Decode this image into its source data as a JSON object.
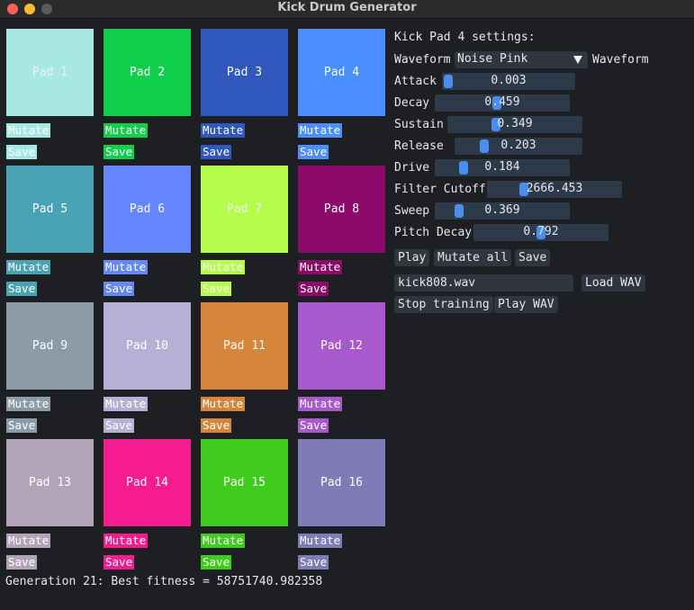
{
  "window": {
    "title": "Kick Drum Generator"
  },
  "pads": [
    {
      "label": "Pad 1",
      "color": "#a7e8e2",
      "text_color": "#f0f0f0",
      "mutate": "Mutate",
      "save": "Save"
    },
    {
      "label": "Pad 2",
      "color": "#10cf4b",
      "text_color": "#ffffff",
      "mutate": "Mutate",
      "save": "Save"
    },
    {
      "label": "Pad 3",
      "color": "#3158bd",
      "text_color": "#ffffff",
      "mutate": "Mutate",
      "save": "Save"
    },
    {
      "label": "Pad 4",
      "color": "#4a8eff",
      "text_color": "#ffffff",
      "mutate": "Mutate",
      "save": "Save"
    },
    {
      "label": "Pad 5",
      "color": "#4aa3b5",
      "text_color": "#ffffff",
      "mutate": "Mutate",
      "save": "Save"
    },
    {
      "label": "Pad 6",
      "color": "#6486ff",
      "text_color": "#ffffff",
      "mutate": "Mutate",
      "save": "Save"
    },
    {
      "label": "Pad 7",
      "color": "#b4fd4b",
      "text_color": "#f0f0f0",
      "mutate": "Mutate",
      "save": "Save"
    },
    {
      "label": "Pad 8",
      "color": "#8b0a6a",
      "text_color": "#ffffff",
      "mutate": "Mutate",
      "save": "Save"
    },
    {
      "label": "Pad 9",
      "color": "#8c9ba8",
      "text_color": "#ffffff",
      "mutate": "Mutate",
      "save": "Save"
    },
    {
      "label": "Pad 10",
      "color": "#b5b1d6",
      "text_color": "#ffffff",
      "mutate": "Mutate",
      "save": "Save"
    },
    {
      "label": "Pad 11",
      "color": "#d5863a",
      "text_color": "#ffffff",
      "mutate": "Mutate",
      "save": "Save"
    },
    {
      "label": "Pad 12",
      "color": "#a859cc",
      "text_color": "#ffffff",
      "mutate": "Mutate",
      "save": "Save"
    },
    {
      "label": "Pad 13",
      "color": "#b3a3b9",
      "text_color": "#ffffff",
      "mutate": "Mutate",
      "save": "Save"
    },
    {
      "label": "Pad 14",
      "color": "#f51c8f",
      "text_color": "#ffffff",
      "mutate": "Mutate",
      "save": "Save"
    },
    {
      "label": "Pad 15",
      "color": "#3fcc1c",
      "text_color": "#ffffff",
      "mutate": "Mutate",
      "save": "Save"
    },
    {
      "label": "Pad 16",
      "color": "#7f7bb6",
      "text_color": "#ffffff",
      "mutate": "Mutate",
      "save": "Save"
    }
  ],
  "settings": {
    "heading": "Kick Pad 4 settings:",
    "waveform": {
      "label": "Waveform",
      "value": "Noise Pink",
      "suffix": "Waveform"
    },
    "params": [
      {
        "label": "Attack",
        "value": "0.003",
        "level": 0.003
      },
      {
        "label": "Decay",
        "value": "0.459",
        "level": 0.459
      },
      {
        "label": "Sustain",
        "value": "0.349",
        "level": 0.349
      },
      {
        "label": "Release",
        "value": "0.203",
        "level": 0.203
      },
      {
        "label": "Drive",
        "value": "0.184",
        "level": 0.184
      },
      {
        "label": "Filter Cutoff",
        "value": "2666.453",
        "level": 0.25
      },
      {
        "label": "Sweep",
        "value": "0.369",
        "level": 0.15
      },
      {
        "label": "Pitch Decay",
        "value": "0.792",
        "level": 0.5
      }
    ],
    "buttons": {
      "play": "Play",
      "mutate_all": "Mutate all",
      "save": "Save"
    },
    "file_input": "kick808.wav",
    "load_wav": "Load WAV",
    "stop_training": "Stop training",
    "play_wav": "Play WAV"
  },
  "status": "Generation 21: Best fitness = 58751740.982358"
}
